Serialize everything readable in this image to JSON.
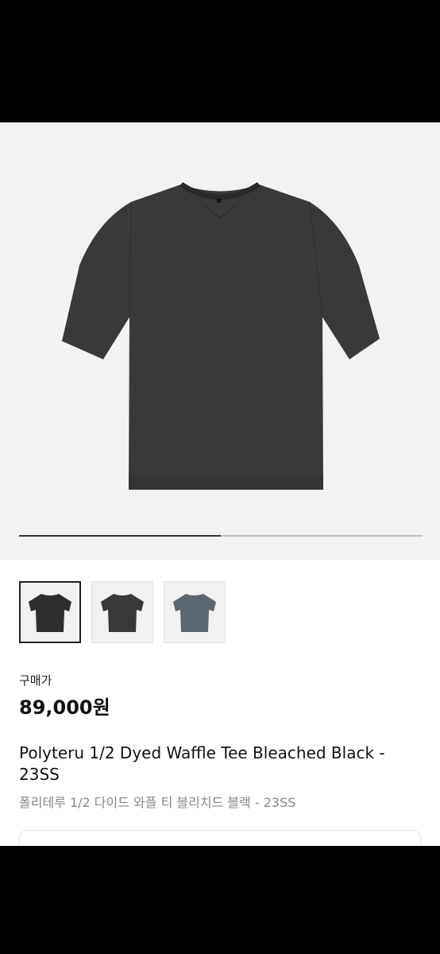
{
  "product": {
    "image_alt": "Polyteru 1/2 Dyed Waffle Tee Bleached Black - 23SS",
    "gallery_progress": 0.5,
    "thumbnail_colors": [
      "#2e2d2b",
      "#3a3937",
      "#5a6670"
    ],
    "price_label": "구매가",
    "price": "89,000원",
    "title": "Polyteru 1/2 Dyed Waffle Tee Bleached Black - 23SS",
    "subtitle": "폴리테루 1/2 다이드 와플 티 블리치드 블랙 - 23SS"
  },
  "colors": {
    "tee_main": "#3b3937",
    "hero_bg": "#f2f2f2"
  }
}
